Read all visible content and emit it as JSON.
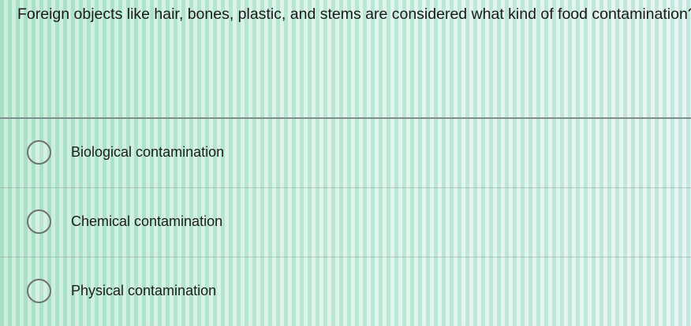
{
  "question": {
    "text": "Foreign objects like hair, bones, plastic, and stems are considered what kind of food contamination?"
  },
  "options": [
    {
      "label": "Biological contamination"
    },
    {
      "label": "Chemical contamination"
    },
    {
      "label": "Physical contamination"
    }
  ]
}
